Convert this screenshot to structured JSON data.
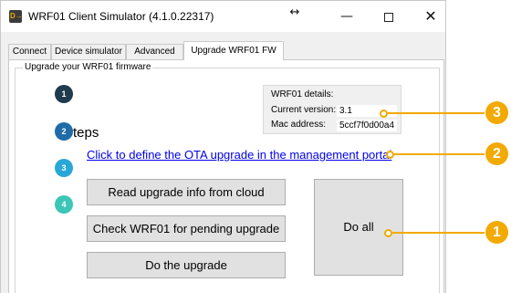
{
  "window": {
    "app_icon_text": "D→",
    "title": "WRF01 Client Simulator (4.1.0.22317)",
    "resize_glyph": "↔",
    "minimize_glyph": "—",
    "close_glyph": "✕"
  },
  "tabs": [
    {
      "label": "Connect"
    },
    {
      "label": "Device simulator"
    },
    {
      "label": "Advanced"
    },
    {
      "label": "Upgrade WRF01 FW",
      "active": true
    }
  ],
  "group": {
    "title": "Upgrade your WRF01 firmware"
  },
  "details": {
    "title": "WRF01 details:",
    "current_version_label": "Current version:",
    "current_version": "3.1",
    "mac_label": "Mac address:",
    "mac_value": "5ccf7f0d00a4"
  },
  "steps": {
    "heading": "Steps",
    "numbers": [
      "1",
      "2",
      "3",
      "4"
    ],
    "ota_link": "Click to define the OTA upgrade in the management portal",
    "read_button": "Read upgrade info from cloud",
    "check_button": "Check WRF01 for pending upgrade",
    "upgrade_button": "Do the upgrade",
    "do_all_button": "Do all"
  },
  "callouts": [
    "1",
    "2",
    "3"
  ],
  "colors": {
    "callout": "#f2a900",
    "step1": "#1f3b4d",
    "step2": "#1f6ca8",
    "step3": "#29a8d8",
    "step4": "#3cc6b8",
    "link": "#0000ee"
  }
}
